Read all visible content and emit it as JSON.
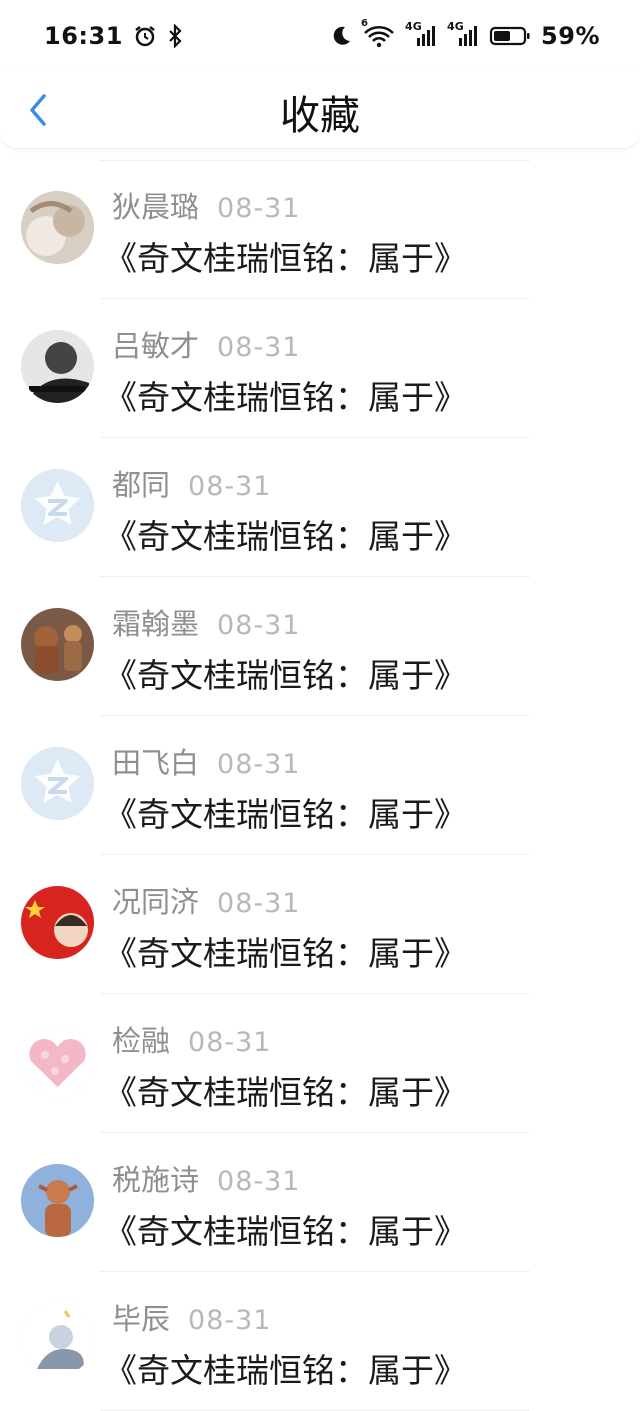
{
  "status_bar": {
    "time": "16:31",
    "battery": "59%",
    "network_1": "4G",
    "network_2": "4G",
    "wifi_badge": "6"
  },
  "header": {
    "title": "收藏"
  },
  "items": [
    {
      "name": "狄晨璐",
      "date": "08-31",
      "message": "《奇文桂瑞恒铭：属于》",
      "avatar": "photo-plush-icon"
    },
    {
      "name": "吕敏才",
      "date": "08-31",
      "message": "《奇文桂瑞恒铭：属于》",
      "avatar": "photo-portrait-icon"
    },
    {
      "name": "都同",
      "date": "08-31",
      "message": "《奇文桂瑞恒铭：属于》",
      "avatar": "default-avatar-icon"
    },
    {
      "name": "霜翰墨",
      "date": "08-31",
      "message": "《奇文桂瑞恒铭：属于》",
      "avatar": "photo-figurines-icon"
    },
    {
      "name": "田飞白",
      "date": "08-31",
      "message": "《奇文桂瑞恒铭：属于》",
      "avatar": "default-avatar-icon"
    },
    {
      "name": "况同济",
      "date": "08-31",
      "message": "《奇文桂瑞恒铭：属于》",
      "avatar": "photo-flag-icon"
    },
    {
      "name": "检融",
      "date": "08-31",
      "message": "《奇文桂瑞恒铭：属于》",
      "avatar": "photo-heart-icon"
    },
    {
      "name": "税施诗",
      "date": "08-31",
      "message": "《奇文桂瑞恒铭：属于》",
      "avatar": "photo-statue-icon"
    },
    {
      "name": "毕辰",
      "date": "08-31",
      "message": "《奇文桂瑞恒铭：属于》",
      "avatar": "photo-sketch-icon"
    }
  ],
  "colors": {
    "accent": "#3a8ee6",
    "name_gray": "#8f8f8f",
    "date_gray": "#b8b8b8",
    "default_avatar_bg": "#dde9f5"
  }
}
